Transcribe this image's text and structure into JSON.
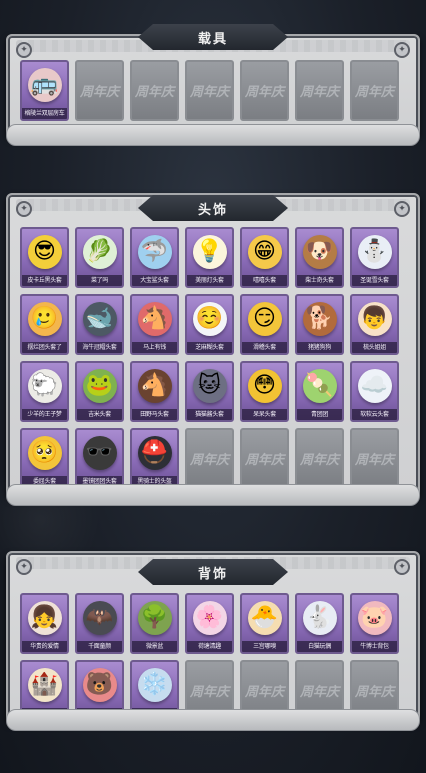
{
  "sections": [
    {
      "id": "vehicle",
      "title": "载具",
      "items": [
        {
          "label": "格陵兰双层房车",
          "icon": "🚌",
          "color": "#e8c9c9"
        },
        {
          "label": "",
          "empty": true
        },
        {
          "label": "",
          "empty": true
        },
        {
          "label": "",
          "empty": true
        },
        {
          "label": "",
          "empty": true
        },
        {
          "label": "",
          "empty": true
        },
        {
          "label": "",
          "empty": true
        }
      ]
    },
    {
      "id": "headwear",
      "title": "头饰",
      "items": [
        {
          "label": "皮卡丘黑头套",
          "icon": "😎",
          "color": "#f3cf3a"
        },
        {
          "label": "菜了吗",
          "icon": "🥬",
          "color": "#dff0d6"
        },
        {
          "label": "大宝鲨头套",
          "icon": "🦈",
          "color": "#9fd0ef"
        },
        {
          "label": "美丽灯头套",
          "icon": "💡",
          "color": "#fbf5dc"
        },
        {
          "label": "嘻嘻头套",
          "icon": "😁",
          "color": "#f5c94a"
        },
        {
          "label": "柴士奇头套",
          "icon": "🐶",
          "color": "#b47c45"
        },
        {
          "label": "圣诞雪头套",
          "icon": "⛄",
          "color": "#e9eef6"
        },
        {
          "label": "摆烂团头套了",
          "icon": "🥲",
          "color": "#f3b64d"
        },
        {
          "label": "海牛冠帽头套",
          "icon": "🐋",
          "color": "#4d5964"
        },
        {
          "label": "马上有钱",
          "icon": "🐴",
          "color": "#e06a6a"
        },
        {
          "label": "芝麻糊头套",
          "icon": "☺️",
          "color": "#f4f6f8"
        },
        {
          "label": "滑稽头套",
          "icon": "😏",
          "color": "#f3c53a"
        },
        {
          "label": "猪猪狗狗",
          "icon": "🐕",
          "color": "#b26b3c"
        },
        {
          "label": "梳头姐姐",
          "icon": "👦",
          "color": "#f7e1c7"
        },
        {
          "label": "少羊的王子梦",
          "icon": "🐑",
          "color": "#ecebe6"
        },
        {
          "label": "吉米头套",
          "icon": "🐸",
          "color": "#7fb24f"
        },
        {
          "label": "田野马头套",
          "icon": "🐴",
          "color": "#6a4330"
        },
        {
          "label": "猫猫酱头套",
          "icon": "🐱",
          "color": "#6d6f83"
        },
        {
          "label": "呆呆头套",
          "icon": "😳",
          "color": "#f2c233"
        },
        {
          "label": "青团团",
          "icon": "🍡",
          "color": "#9ed36f"
        },
        {
          "label": "软软云头套",
          "icon": "☁️",
          "color": "#eef2f8"
        },
        {
          "label": "委屈头套",
          "icon": "🥺",
          "color": "#f3c53a"
        },
        {
          "label": "墨镜团团头套",
          "icon": "🕶️",
          "color": "#3a3a3a"
        },
        {
          "label": "黑骑士的头盔",
          "icon": "⛑️",
          "color": "#2d2f36"
        },
        {
          "label": "",
          "empty": true
        },
        {
          "label": "",
          "empty": true
        },
        {
          "label": "",
          "empty": true
        },
        {
          "label": "",
          "empty": true
        }
      ]
    },
    {
      "id": "back",
      "title": "背饰",
      "items": [
        {
          "label": "华贵的爱情",
          "icon": "👧",
          "color": "#efe1d7"
        },
        {
          "label": "千面童颜",
          "icon": "🦇",
          "color": "#4a4b52"
        },
        {
          "label": "微景盆",
          "icon": "🌳",
          "color": "#7ea34f"
        },
        {
          "label": "荷塘清趣",
          "icon": "🌸",
          "color": "#f3d6e6"
        },
        {
          "label": "三宫哪嗅",
          "icon": "🐣",
          "color": "#f5ddb1"
        },
        {
          "label": "白猫玩偶",
          "icon": "🐇",
          "color": "#e8ecf4"
        },
        {
          "label": "牛博士背包",
          "icon": "🐷",
          "color": "#f1b9bf"
        },
        {
          "label": "晒太阳",
          "icon": "🏰",
          "color": "#f2e4c9"
        },
        {
          "label": "大风兮帽",
          "icon": "🐻",
          "color": "#e88a8a"
        },
        {
          "label": "冰晶姬",
          "icon": "❄️",
          "color": "#c6dcef"
        },
        {
          "label": "",
          "empty": true
        },
        {
          "label": "",
          "empty": true
        },
        {
          "label": "",
          "empty": true
        },
        {
          "label": "",
          "empty": true
        }
      ]
    }
  ],
  "placeholder_text": "周年庆"
}
